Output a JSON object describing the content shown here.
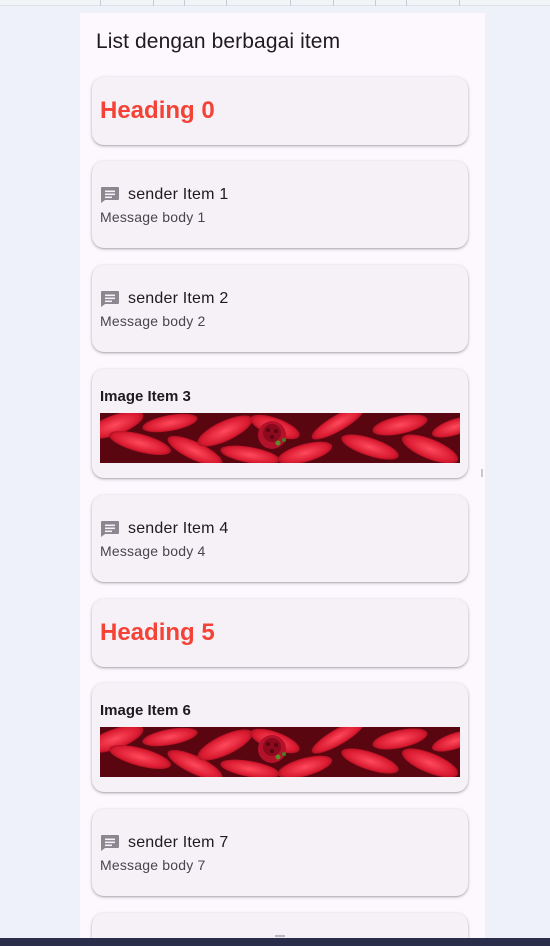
{
  "app": {
    "title": "List dengan berbagai item"
  },
  "colors": {
    "heading": "#f44336",
    "card_bg": "#f6f0f7",
    "page_bg": "#fdf7fe",
    "desktop_bg": "#eef1f9"
  },
  "items": [
    {
      "type": "heading",
      "text": "Heading 0"
    },
    {
      "type": "message",
      "icon": "message-icon",
      "sender": "sender Item 1",
      "body": "Message body 1"
    },
    {
      "type": "message",
      "icon": "message-icon",
      "sender": "sender Item 2",
      "body": "Message body 2"
    },
    {
      "type": "image",
      "title": "Image Item 3",
      "image": "red-flower-image"
    },
    {
      "type": "message",
      "icon": "message-icon",
      "sender": "sender Item 4",
      "body": "Message body 4"
    },
    {
      "type": "heading",
      "text": "Heading 5"
    },
    {
      "type": "image",
      "title": "Image Item 6",
      "image": "red-flower-image"
    },
    {
      "type": "message",
      "icon": "message-icon",
      "sender": "sender Item 7",
      "body": "Message body 7"
    }
  ]
}
